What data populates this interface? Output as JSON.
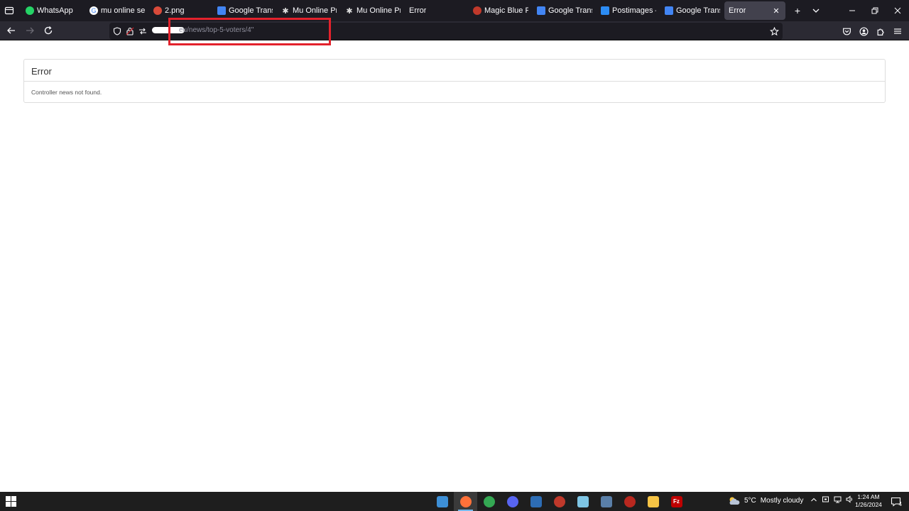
{
  "browser": {
    "tabs": [
      {
        "title": "WhatsApp",
        "icon": "whatsapp-icon",
        "color": "#25d366"
      },
      {
        "title": "mu online season",
        "icon": "google-icon",
        "color": "#ffffff"
      },
      {
        "title": "2.png",
        "icon": "image-icon",
        "color": "#d94a3a"
      },
      {
        "title": "Google Translate",
        "icon": "google-translate-icon",
        "color": "#4285f4"
      },
      {
        "title": "Mu Online Privat",
        "icon": "gear-icon",
        "color": "#dddddd"
      },
      {
        "title": "Mu Online Privat",
        "icon": "gear-icon",
        "color": "#dddddd"
      },
      {
        "title": "Error",
        "icon": "",
        "color": ""
      },
      {
        "title": "Magic Blue Froze",
        "icon": "game-icon",
        "color": "#c0392b"
      },
      {
        "title": "Google Translate",
        "icon": "google-translate-icon",
        "color": "#4285f4"
      },
      {
        "title": "Postimages — gi",
        "icon": "postimages-icon",
        "color": "#2c8cf4"
      },
      {
        "title": "Google Translate",
        "icon": "google-translate-icon",
        "color": "#4285f4"
      },
      {
        "title": "Error",
        "icon": "",
        "color": "",
        "active": true
      }
    ],
    "url": "eu/news/top-5-voters/4\"",
    "new_tab_symbol": "+",
    "list_tabs_symbol": "⌄"
  },
  "page": {
    "heading": "Error",
    "message": "Controller news not found."
  },
  "taskbar": {
    "pins": [
      {
        "name": "explorer-pin-icon",
        "color": "#3d8fd6",
        "glyph": "",
        "active": false
      },
      {
        "name": "firefox-pin-icon",
        "color": "#ff7139",
        "glyph": "",
        "active": true
      },
      {
        "name": "chrome-pin-icon",
        "color": "#34a853",
        "glyph": "",
        "active": false
      },
      {
        "name": "discord-pin-icon",
        "color": "#5865f2",
        "glyph": "",
        "active": false
      },
      {
        "name": "remote-desktop-pin-icon",
        "color": "#2d6db5",
        "glyph": "",
        "active": false
      },
      {
        "name": "game-launcher-pin-icon",
        "color": "#c0392b",
        "glyph": "",
        "active": false
      },
      {
        "name": "notepad-pin-icon",
        "color": "#7fc6e5",
        "glyph": "",
        "active": false
      },
      {
        "name": "calculator-pin-icon",
        "color": "#5a7fa8",
        "glyph": "",
        "active": false
      },
      {
        "name": "game-launcher-2-pin-icon",
        "color": "#b9281f",
        "glyph": "",
        "active": false
      },
      {
        "name": "file-explorer-pin-icon",
        "color": "#f6c445",
        "glyph": "",
        "active": false
      },
      {
        "name": "filezilla-pin-icon",
        "color": "#bf0000",
        "glyph": "Fz",
        "active": false
      }
    ],
    "weather": {
      "temp": "5°C",
      "condition": "Mostly cloudy"
    },
    "clock": {
      "time": "1:24 AM",
      "date": "1/26/2024"
    },
    "notifications": "4"
  },
  "colors": {
    "annotation_box": "#e3222c",
    "tab_strip": "#1c1b22",
    "nav_bar": "#2b2a33",
    "active_tab": "#42414d"
  }
}
